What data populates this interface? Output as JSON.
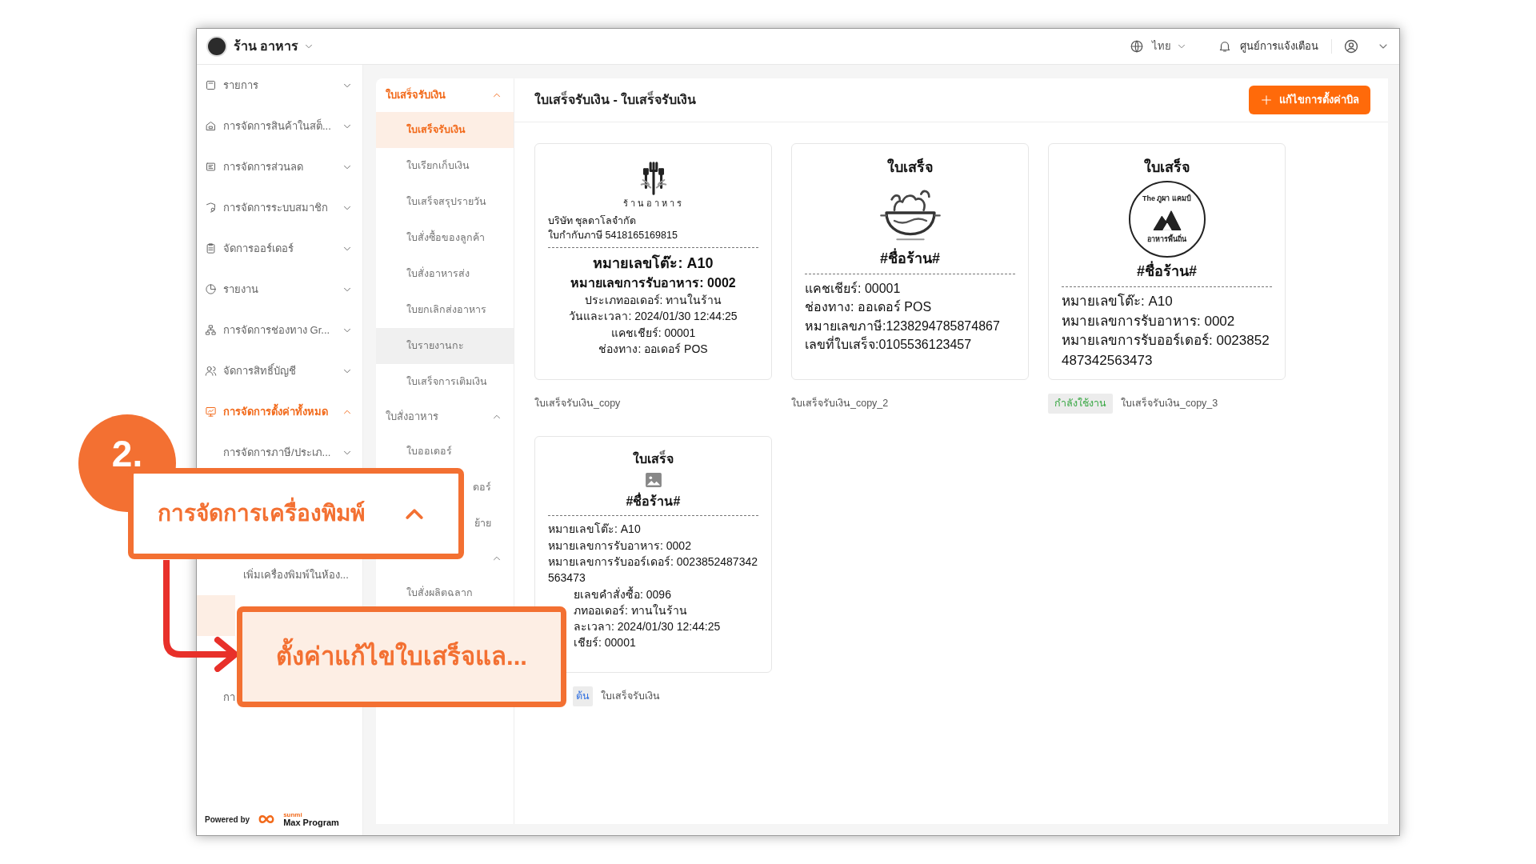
{
  "topbar": {
    "store_name": "ร้าน อาหาร",
    "language": "ไทย",
    "notifications": "ศูนย์การแจ้งเตือน"
  },
  "sidebar": {
    "items": [
      {
        "label": "รายการ",
        "expanded": false,
        "selected": false
      },
      {
        "label": "การจัดการสินค้าในสต็...",
        "expanded": false,
        "selected": false
      },
      {
        "label": "การจัดการส่วนลด",
        "expanded": false,
        "selected": false
      },
      {
        "label": "การจัดการระบบสมาชิก",
        "expanded": false,
        "selected": false
      },
      {
        "label": "จัดการออร์เดอร์",
        "expanded": false,
        "selected": false
      },
      {
        "label": "รายงาน",
        "expanded": false,
        "selected": false
      },
      {
        "label": "การจัดการช่องทาง Gr...",
        "expanded": false,
        "selected": false
      },
      {
        "label": "จัดการสิทธิ์บัญชี",
        "expanded": false,
        "selected": false
      },
      {
        "label": "การจัดการตั้งค่าทั้งหมด",
        "expanded": true,
        "selected": true,
        "children": [
          {
            "label": "การจัดการภาษี/ประเภ...",
            "kind": "sub",
            "selected": false
          },
          {
            "label": "เพิ่มเครื่องพิมพ์ในห้อง...",
            "kind": "deep",
            "selected": false
          },
          {
            "kind": "deep",
            "selected": true
          },
          {
            "label": "กา",
            "kind": "sub",
            "selected": false
          }
        ]
      }
    ],
    "footer": {
      "prefix": "Powered by",
      "brand_small": "sunmi",
      "brand": "Max Program"
    }
  },
  "submenu": [
    {
      "title": "ใบเสร็จรับเงิน",
      "expanded": true,
      "selected": true,
      "items": [
        {
          "label": "ใบเสร็จรับเงิน",
          "selected": true
        },
        {
          "label": "ใบเรียกเก็บเงิน",
          "selected": false,
          "highlighted": false
        },
        {
          "label": "ใบเสร็จสรุปรายวัน",
          "selected": false,
          "highlighted": false
        },
        {
          "label": "ใบสั่งซื้อของลูกค้า",
          "selected": false,
          "highlighted": false
        },
        {
          "label": "ใบสั่งอาหารส่ง",
          "selected": false,
          "highlighted": false
        },
        {
          "label": "ใบยกเลิกส่งอาหาร",
          "selected": false,
          "highlighted": false
        },
        {
          "label": "ใบรายงานกะ",
          "selected": false,
          "highlighted": true
        },
        {
          "label": "ใบเสร็จการเติมเงิน",
          "selected": false,
          "highlighted": false
        }
      ]
    },
    {
      "title": "ใบสั่งอาหาร",
      "expanded": true,
      "selected": false,
      "items": [
        {
          "label": "ใบออเดอร์",
          "selected": false,
          "highlighted": false
        },
        {
          "label": "ดอร์",
          "kind": "partial",
          "selected": false,
          "highlighted": false
        },
        {
          "label": "ย้าย",
          "kind": "partial",
          "selected": false,
          "highlighted": false
        }
      ]
    },
    {
      "expanded": true,
      "selected": false,
      "items": [
        {
          "label": "ใบสั่งผลิตฉลาก",
          "selected": false,
          "highlighted": false
        }
      ]
    }
  ],
  "main": {
    "title": "ใบเสร็จรับเงิน - ใบเสร็จรับเงิน",
    "button": "แก้ไขการตั้งค่าบิล",
    "templates": [
      {
        "caption": "ใบเสร็จรับเงิน_copy",
        "lines": [
          {
            "kind": "forks-logo",
            "logo_texts": [
              "ร้านอาหาร"
            ]
          },
          {
            "text": "บริษัท ชุลดาโลจำกัด",
            "kind": "left"
          },
          {
            "text": "ใบกำกับภาษี 5418165169815",
            "kind": "left"
          },
          {
            "kind": "dash"
          },
          {
            "text": "หมายเลขโต๊ะ: A10",
            "kind": "bold-large"
          },
          {
            "text": "หมายเลขการรับอาหาร: 0002",
            "kind": "bold"
          },
          {
            "text": "ประเภทออเดอร์: ทานในร้าน",
            "kind": "center"
          },
          {
            "text": "วันและเวลา: 2024/01/30 12:44:25",
            "kind": "center"
          },
          {
            "text": "แคชเชียร์: 00001",
            "kind": "center"
          },
          {
            "text": "ช่องทาง: ออเดอร์ POS",
            "kind": "center"
          }
        ]
      },
      {
        "caption": "ใบเสร็จรับเงิน_copy_2",
        "lines": [
          {
            "text": "ใบเสร็จ",
            "kind": "heading"
          },
          {
            "kind": "bowl-logo"
          },
          {
            "text": "#ชื่อร้าน#",
            "kind": "heading"
          },
          {
            "kind": "dash"
          },
          {
            "text": "แคชเชียร์: 00001",
            "kind": "left"
          },
          {
            "text": "ช่องทาง: ออเดอร์ POS",
            "kind": "left"
          },
          {
            "text": "หมายเลขภาษี:1238294785874867",
            "kind": "left"
          },
          {
            "text": "เลขที่ใบเสร็จ:0105536123457",
            "kind": "left"
          }
        ]
      },
      {
        "caption": "ใบเสร็จรับเงิน_copy_3",
        "badge": {
          "text": "กำลังใช้งาน",
          "kind": "active"
        },
        "lines": [
          {
            "text": "ใบเสร็จ",
            "kind": "heading"
          },
          {
            "kind": "camp-logo",
            "logo_texts": [
              "The ภูผา แคมป์",
              "อาหารพื้นถิ่น"
            ]
          },
          {
            "text": "#ชื่อร้าน#",
            "kind": "heading"
          },
          {
            "kind": "dash"
          },
          {
            "text": "หมายเลขโต๊ะ: A10",
            "kind": "left"
          },
          {
            "text": "หมายเลขการรับอาหาร: 0002",
            "kind": "left"
          },
          {
            "text": "หมายเลขการรับออร์เดอร์: 0023852487342563473",
            "kind": "left"
          }
        ]
      },
      {
        "caption": "ใบเสร็จรับเงิน",
        "badge": {
          "text": "ต้น",
          "kind": "default"
        },
        "lines": [
          {
            "text": "ใบเสร็จ",
            "kind": "heading"
          },
          {
            "kind": "image-placeholder"
          },
          {
            "text": "#ชื่อร้าน#",
            "kind": "heading"
          },
          {
            "kind": "dash"
          },
          {
            "text": "หมายเลขโต๊ะ: A10",
            "kind": "left"
          },
          {
            "text": "หมายเลขการรับอาหาร: 0002",
            "kind": "left"
          },
          {
            "text": "หมายเลขการรับออร์เดอร์: 0023852487342563473",
            "kind": "left"
          },
          {
            "text": "ยเลขคำสั่งซื้อ: 0096",
            "kind": "partial"
          },
          {
            "text": "ภทออเดอร์: ทานในร้าน",
            "kind": "partial"
          },
          {
            "text": "ละเวลา: 2024/01/30 12:44:25",
            "kind": "partial"
          },
          {
            "text": "เชียร์: 00001",
            "kind": "partial"
          }
        ]
      }
    ]
  },
  "annotation": {
    "step": "2.",
    "callouts": [
      {
        "text": "การจัดการเครื่องพิมพ์",
        "kind": "group"
      },
      {
        "text": "ตั้งค่าแก้ไขใบเสร็จแล...",
        "kind": "item"
      }
    ]
  }
}
